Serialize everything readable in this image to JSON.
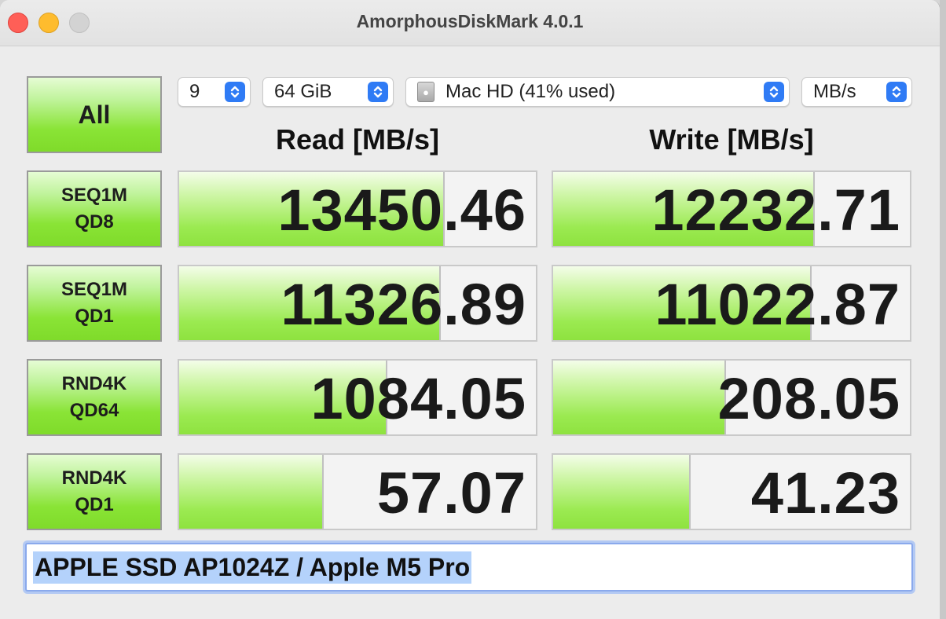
{
  "window": {
    "title": "AmorphousDiskMark 4.0.1"
  },
  "controls": {
    "all_label": "All",
    "count": "9",
    "size": "64 GiB",
    "disk": "Mac HD (41% used)",
    "unit": "MB/s"
  },
  "headers": {
    "read": "Read [MB/s]",
    "write": "Write [MB/s]"
  },
  "tests": [
    {
      "line1": "SEQ1M",
      "line2": "QD8",
      "read": "13450.46",
      "write": "12232.71",
      "read_fill": 0.74,
      "write_fill": 0.73
    },
    {
      "line1": "SEQ1M",
      "line2": "QD1",
      "read": "11326.89",
      "write": "11022.87",
      "read_fill": 0.73,
      "write_fill": 0.72
    },
    {
      "line1": "RND4K",
      "line2": "QD64",
      "read": "1084.05",
      "write": "208.05",
      "read_fill": 0.58,
      "write_fill": 0.48
    },
    {
      "line1": "RND4K",
      "line2": "QD1",
      "read": "57.07",
      "write": "41.23",
      "read_fill": 0.4,
      "write_fill": 0.38
    }
  ],
  "info": "APPLE SSD AP1024Z / Apple M5 Pro",
  "colors": {
    "accent_blue": "#2f7bf5",
    "green": "#8ee23f"
  }
}
